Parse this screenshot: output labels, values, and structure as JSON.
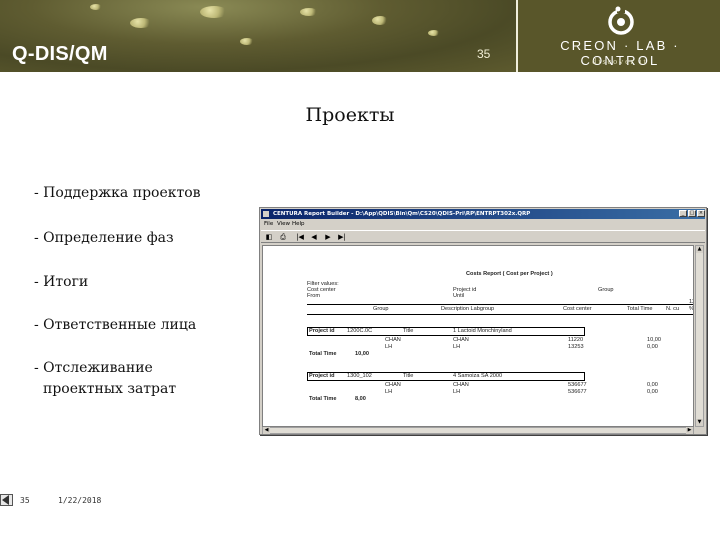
{
  "header": {
    "app_title": "Q-DIS/QM",
    "page_number": "35",
    "company_name": "CREON · LAB · CONTROL",
    "company_tagline": "discover it"
  },
  "slide": {
    "title": "Проекты",
    "bullets": [
      "- Поддержка проектов",
      "- Определение фаз",
      "- Итоги",
      "- Ответственные лица",
      "- Отслеживание",
      "проектных затрат"
    ]
  },
  "embedded_app": {
    "window_title": "CENTURA Report Builder - D:\\App\\QDIS\\Bin\\Qm\\CS20\\QDIS-Pri\\RP\\ENTRPT302x.QRP",
    "window_controls": [
      "_",
      "□",
      "×"
    ],
    "menu": [
      "File",
      "View",
      "Help"
    ],
    "toolbar": [
      "◧",
      "⎙",
      "|◀",
      "◀",
      "▶",
      "▶|"
    ],
    "report": {
      "title": "Costs Report ( Cost per Project )",
      "filter_labels": [
        "Filter values:",
        "Cost center",
        "From"
      ],
      "filter_fields": [
        "Project id",
        "Until"
      ],
      "filter_right": [
        "Group"
      ],
      "corner_value": "12",
      "columns": [
        "Group",
        "Description Labgroup",
        "Cost center",
        "Total Time",
        "N. cu",
        "%"
      ],
      "projects": [
        {
          "project_label": "Project id",
          "project_id": "1200C.0C",
          "title_label": "Title",
          "title_value": "1   Lactoid Monchinyland",
          "rows": [
            {
              "group": "CHAN",
              "labgroup": "CHAN",
              "cost_center": "11220",
              "total_time": "10,00"
            },
            {
              "group": "LH",
              "labgroup": "LH",
              "cost_center": "13253",
              "total_time": "0,00"
            }
          ],
          "total_label": "Total Time",
          "total_value": "10,00"
        },
        {
          "project_label": "Project id",
          "project_id": "1300_102",
          "title_label": "Title",
          "title_value": "4   Samoiza SA 2000",
          "rows": [
            {
              "group": "CHAN",
              "labgroup": "CHAN",
              "cost_center": "536677",
              "total_time": "0,00"
            },
            {
              "group": "LH",
              "labgroup": "LH",
              "cost_center": "536677",
              "total_time": "0,00"
            }
          ],
          "total_label": "Total Time",
          "total_value": "8,00"
        }
      ]
    }
  },
  "footer": {
    "page_number": "35",
    "date": "1/22/2018"
  },
  "colors": {
    "header_olive": "#5e5b2d",
    "logo_panel": "#59562a",
    "window_title_blue": "#0a246a"
  }
}
